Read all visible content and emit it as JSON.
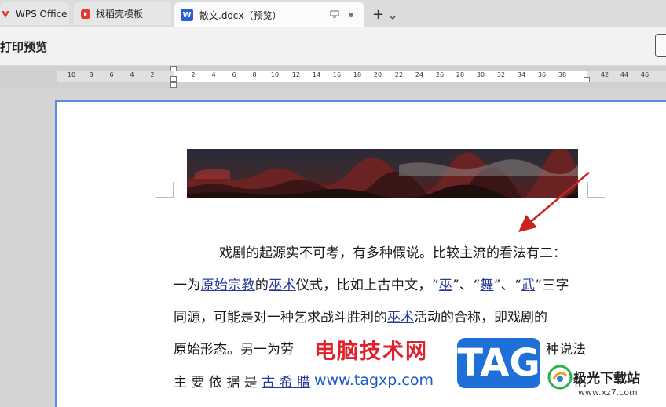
{
  "tabs": [
    {
      "label": "WPS Office",
      "icon": "wps-logo-icon",
      "color": "#e03a2f"
    },
    {
      "label": "找稻壳模板",
      "icon": "docer-logo-icon",
      "color": "#e03a2f"
    },
    {
      "label": "散文.docx（预览）",
      "icon": "word-doc-icon",
      "icon_letter": "W",
      "color": "#2b5cd6"
    }
  ],
  "toolbar": {
    "title": "打印预览"
  },
  "ruler": {
    "left_ticks": [
      "10",
      "8",
      "6",
      "4",
      "2",
      "2",
      "2",
      "4",
      "6",
      "8",
      "10",
      "12",
      "14",
      "16",
      "18",
      "20",
      "22",
      "24",
      "26",
      "28",
      "30",
      "32",
      "34",
      "36",
      "38",
      "42",
      "44",
      "46"
    ]
  },
  "document": {
    "line1": "戏剧的起源实不可考，有多种假说。比较主流的看法有二：",
    "line2": {
      "p1": "一为",
      "l1": "原始宗教",
      "p2": "的",
      "l2": "巫术",
      "p3": "仪式，比如上古中文，“",
      "l3": "巫",
      "p4": "”、“",
      "l4": "舞",
      "p5": "”、“",
      "l5": "武",
      "p6": "”三字"
    },
    "line3": {
      "p1": "同源，可能是对一种乞求战斗胜利的",
      "l1": "巫术",
      "p2": "活动的合称，即戏剧的"
    },
    "line4": {
      "p1": "原始形态。另一为劳",
      "p2": "种说法"
    },
    "line5": {
      "p1": "主 要 依 据 是 ",
      "l1": "古 希 腊",
      "p2": "祭 祀"
    }
  },
  "watermarks": {
    "cn": "电脑技术网",
    "url": "www.tagxp.com",
    "tag": "TAG",
    "jiguang": "极光下载站",
    "jiguang_url": "www.xz7.com"
  },
  "colors": {
    "accent": "#5b8de0",
    "arrow": "#cc2222",
    "link": "#2a3a9a"
  }
}
